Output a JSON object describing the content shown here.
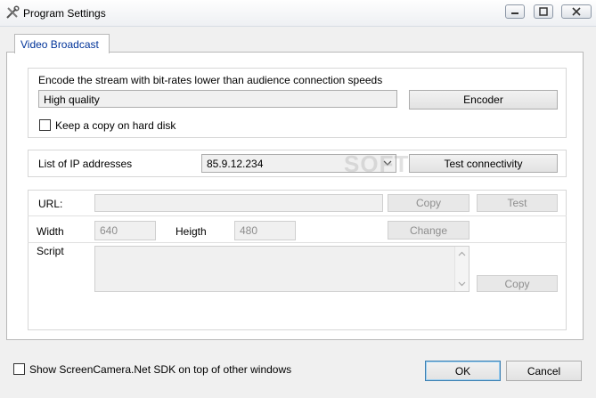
{
  "window": {
    "title": "Program Settings"
  },
  "tabs": [
    {
      "label": "Video Broadcast"
    }
  ],
  "encode": {
    "description": "Encode the stream with bit-rates lower than audience connection speeds",
    "quality_value": "High quality",
    "encoder_button": "Encoder",
    "keep_copy_label": "Keep a copy on hard disk",
    "keep_copy_checked": false
  },
  "ip": {
    "label": "List of IP addresses",
    "selected": "85.9.12.234",
    "test_button": "Test connectivity"
  },
  "url": {
    "label": "URL:",
    "value": "",
    "copy_button": "Copy",
    "test_button": "Test"
  },
  "size": {
    "width_label": "Width",
    "width_value": "640",
    "height_label": "Heigth",
    "height_value": "480",
    "change_button": "Change"
  },
  "script": {
    "label": "Script",
    "value": "",
    "copy_button": "Copy"
  },
  "footer": {
    "ontop_label": "Show ScreenCamera.Net SDK on top of other windows",
    "ontop_checked": false,
    "ok_button": "OK",
    "cancel_button": "Cancel"
  },
  "watermark": "SOFTPEDIA",
  "icons": {
    "app": "tools-icon",
    "minimize": "minimize-icon",
    "maximize": "maximize-icon",
    "close": "close-icon"
  },
  "colors": {
    "tab_text": "#003399",
    "default_button_border": "#3c7fb1"
  }
}
